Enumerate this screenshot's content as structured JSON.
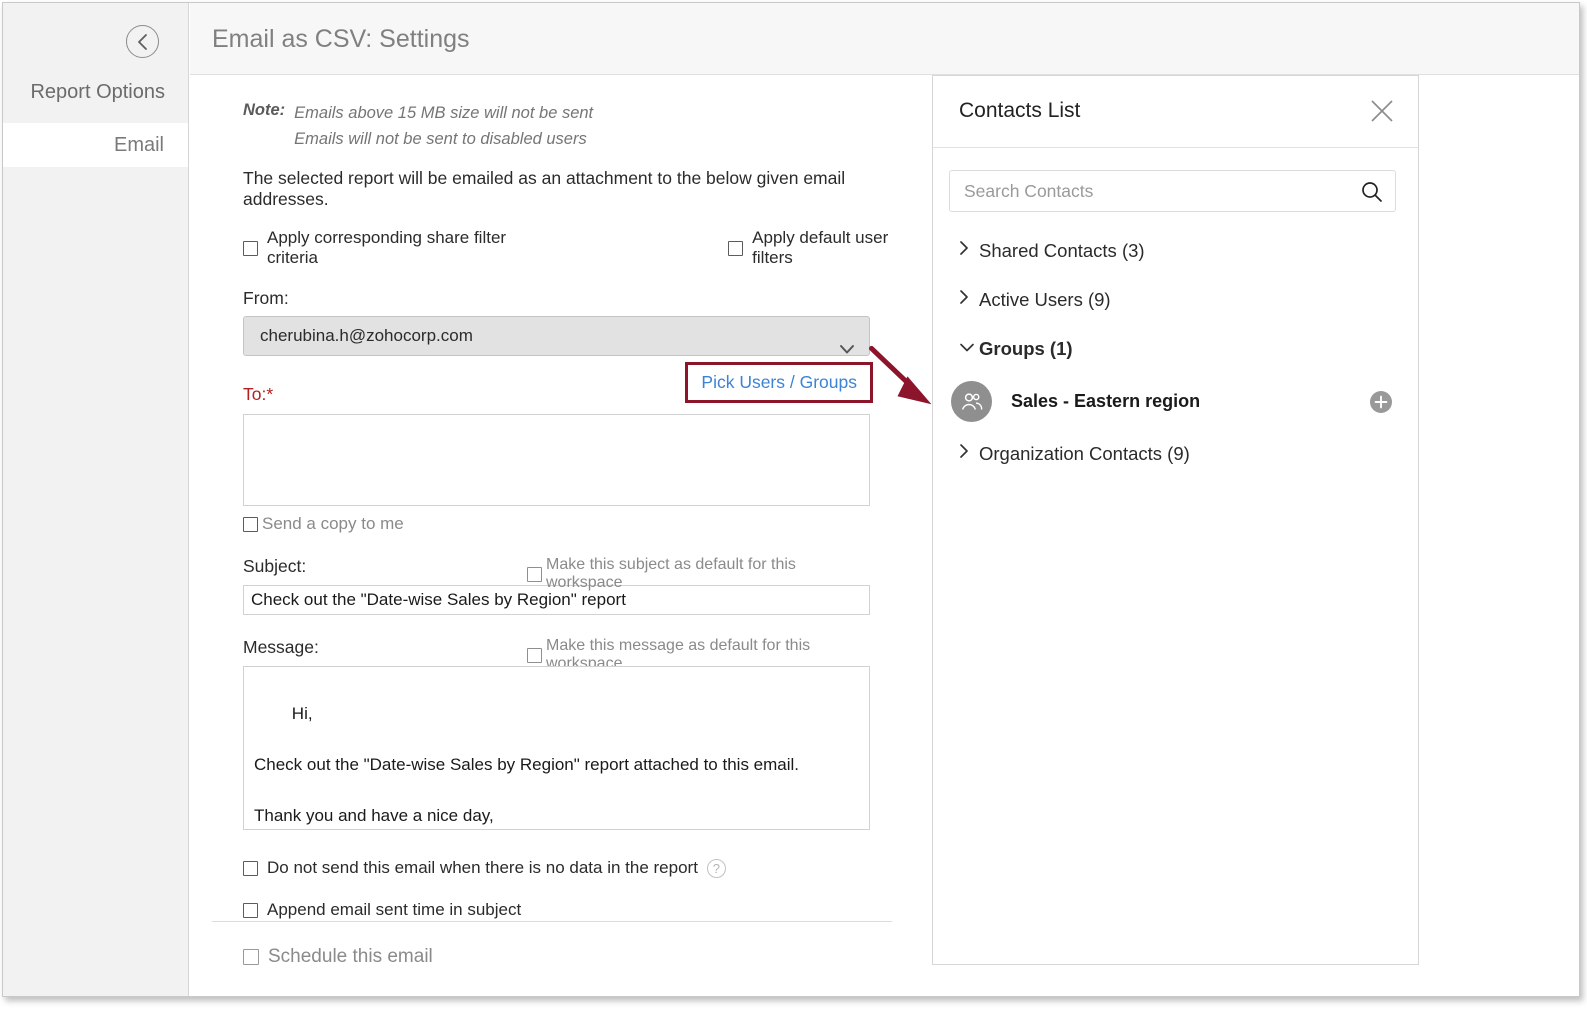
{
  "window": {
    "title": "Email as CSV: Settings"
  },
  "sidebar": {
    "back_icon": "chevron-left-circle-icon",
    "heading": "Report Options",
    "items": [
      {
        "label": "Email",
        "selected": true
      }
    ]
  },
  "form": {
    "note": {
      "label": "Note:",
      "lines": [
        "Emails above  15 MB size will not be sent",
        "Emails will not be sent to disabled users"
      ]
    },
    "intro": "The selected report will be emailed as an attachment to the below given email addresses.",
    "filters": [
      {
        "label": "Apply corresponding share filter criteria",
        "checked": false
      },
      {
        "label": "Apply default user filters",
        "checked": false
      }
    ],
    "from": {
      "label": "From:",
      "value": "cherubina.h@zohocorp.com",
      "chevron_icon": "chevron-down-icon"
    },
    "to": {
      "label": "To:*",
      "value": "",
      "pick_users_link": "Pick Users / Groups"
    },
    "send_copy": {
      "label": "Send a copy to me",
      "checked": false
    },
    "subject": {
      "label": "Subject:",
      "value": "Check out the \"Date-wise Sales by Region\" report",
      "default_checkbox": "Make this subject as default for this workspace"
    },
    "message": {
      "label": "Message:",
      "value": "Hi,\n\nCheck out the \"Date-wise Sales by Region\" report attached to this email.\n\nThank you and have a nice day,\nAdmin",
      "default_checkbox": "Make this message as default for this workspace"
    },
    "options": [
      {
        "label": "Do not send this email when there is no data in the report",
        "checked": false,
        "help_icon": "question-mark-icon",
        "help_glyph": "?"
      },
      {
        "label": "Append email sent time in subject",
        "checked": false
      },
      {
        "label": "Schedule this email",
        "checked": false,
        "disabled": true
      }
    ]
  },
  "contacts_panel": {
    "title": "Contacts List",
    "close_icon": "close-icon",
    "search": {
      "placeholder": "Search Contacts",
      "value": "",
      "icon": "search-icon"
    },
    "tree": [
      {
        "label": "Shared Contacts (3)",
        "expanded": false,
        "caret_icon": "chevron-right-icon"
      },
      {
        "label": "Active Users (9)",
        "expanded": false,
        "caret_icon": "chevron-right-icon"
      },
      {
        "label": "Groups (1)",
        "expanded": true,
        "caret_icon": "chevron-down-icon"
      },
      {
        "label": "Organization Contacts (9)",
        "expanded": false,
        "caret_icon": "chevron-right-icon"
      }
    ],
    "group": {
      "name": "Sales - Eastern region",
      "avatar_icon": "users-group-icon",
      "add_icon": "plus-icon"
    }
  },
  "annotation": {
    "color": "#8c152b",
    "type": "callout-arrow",
    "from": "pick-users-groups-link",
    "to": "group-item-sales-eastern-region"
  }
}
